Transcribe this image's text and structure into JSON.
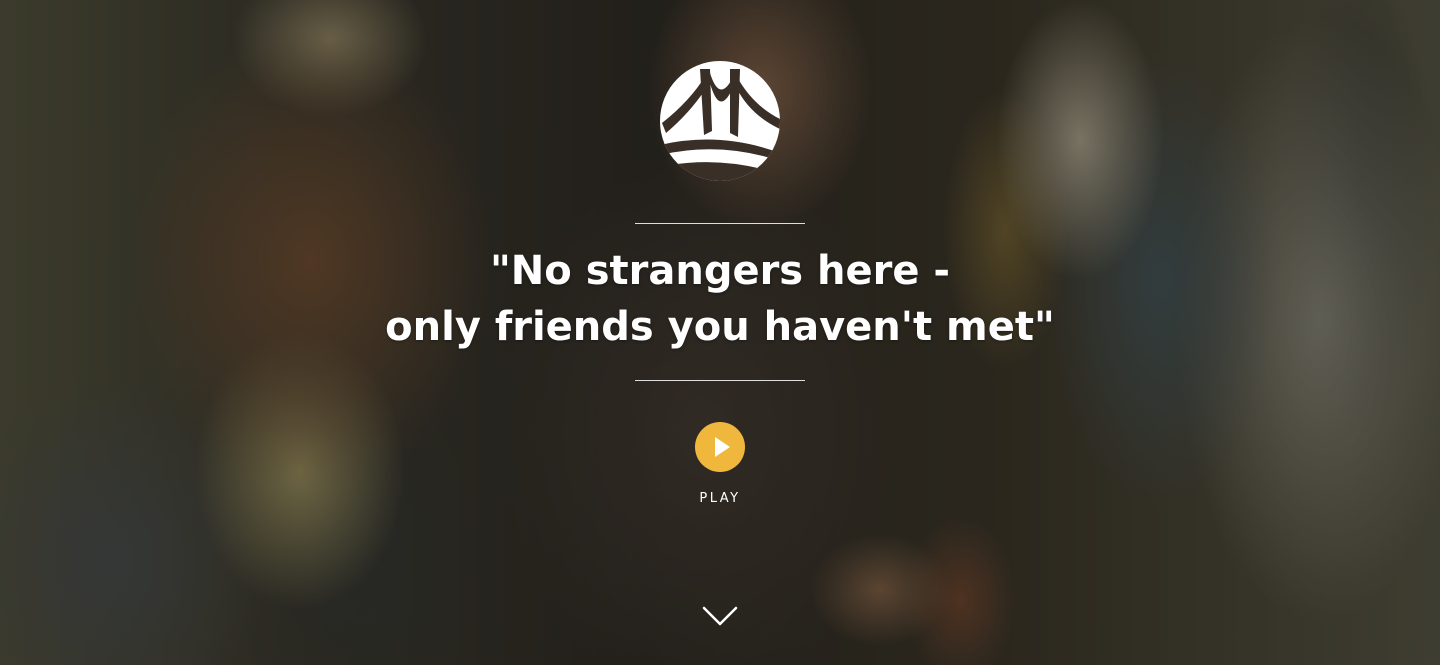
{
  "hero": {
    "quote_line1": "\"No strangers here -",
    "quote_line2": "only friends you haven't met\"",
    "play_label": "PLAY"
  },
  "icons": {
    "logo": "bridge-logo-icon",
    "play": "play-icon",
    "scroll": "chevron-down-icon"
  },
  "colors": {
    "accent": "#f0b73d",
    "text": "#ffffff"
  }
}
